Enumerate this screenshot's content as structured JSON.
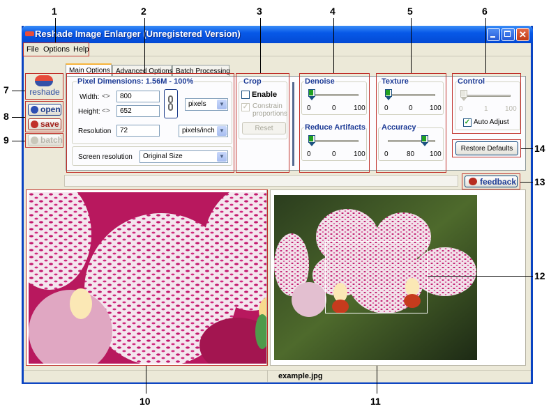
{
  "window": {
    "title": "Reshade Image Enlarger (Unregistered Version)",
    "title_color": "#0759e8"
  },
  "menu": [
    "File",
    "Options",
    "Help"
  ],
  "sidebar": {
    "logo_text": "reshade",
    "open_label": "open",
    "save_label": "save",
    "batch_label": "batch"
  },
  "tabs": [
    "Main Options",
    "Advanced Options",
    "Batch Processing"
  ],
  "pixel_dimensions": {
    "title": "Pixel Dimensions: 1.56M - 100%",
    "width_label": "Width:",
    "width_value": "800",
    "height_label": "Height:",
    "height_value": "652",
    "unit": "pixels",
    "resolution_label": "Resolution",
    "resolution_value": "72",
    "resolution_unit": "pixels/inch",
    "screen_resolution_label": "Screen resolution",
    "screen_resolution_value": "Original Size"
  },
  "crop": {
    "title": "Crop",
    "enable_label": "Enable",
    "constrain_label_1": "Constrain",
    "constrain_label_2": "proportions",
    "reset_label": "Reset"
  },
  "denoise": {
    "title": "Denoise",
    "min": "0",
    "value": "0",
    "max": "100",
    "level": 0
  },
  "reduce_artifacts": {
    "title": "Reduce Artifacts",
    "min": "0",
    "value": "0",
    "max": "100",
    "level": 0
  },
  "texture": {
    "title": "Texture",
    "min": "0",
    "value": "0",
    "max": "100",
    "level": 0
  },
  "accuracy": {
    "title": "Accuracy",
    "min": "0",
    "value": "80",
    "max": "100",
    "level": 80
  },
  "control": {
    "title": "Control",
    "min": "0",
    "value": "1",
    "max": "100",
    "auto_adjust_label": "Auto Adjust",
    "auto_adjust_checked": true
  },
  "restore_defaults_label": "Restore Defaults",
  "feedback_label": "feedback",
  "status": {
    "filename": "example.jpg"
  },
  "callouts": [
    "1",
    "2",
    "3",
    "4",
    "5",
    "6",
    "7",
    "8",
    "9",
    "10",
    "11",
    "12",
    "13",
    "14"
  ],
  "colors": {
    "callout_box": "#c0302a",
    "group_title": "#1e3c96",
    "slider_green": "#21a121"
  }
}
